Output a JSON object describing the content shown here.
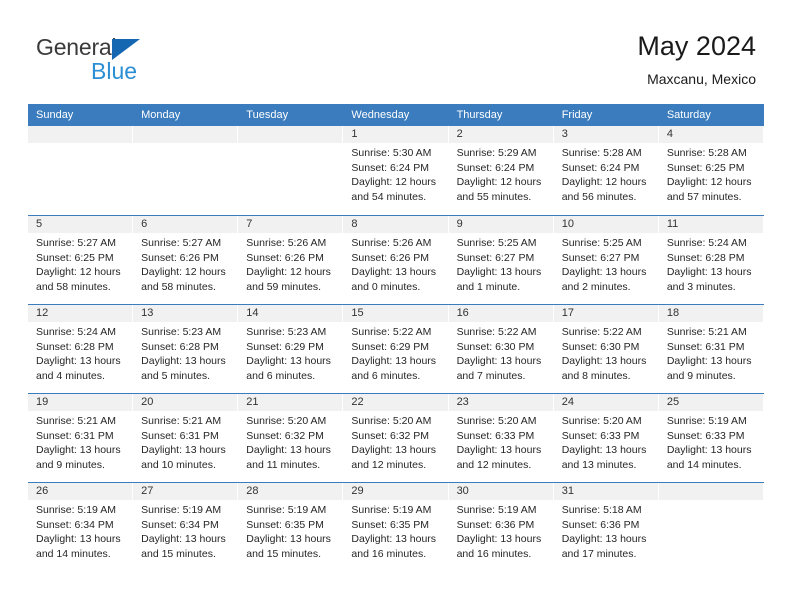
{
  "brand": {
    "name_top": "General",
    "name_bottom": "Blue",
    "triangle_color": "#1667b2",
    "blue_text_color": "#2a8fd4"
  },
  "header": {
    "title": "May 2024",
    "subtitle": "Maxcanu, Mexico"
  },
  "theme": {
    "header_blue": "#3a7cbe",
    "daynum_strip": "#f1f1f1",
    "text": "#262626"
  },
  "weekdays": [
    "Sunday",
    "Monday",
    "Tuesday",
    "Wednesday",
    "Thursday",
    "Friday",
    "Saturday"
  ],
  "weeks": [
    [
      {
        "day": "",
        "lines": []
      },
      {
        "day": "",
        "lines": []
      },
      {
        "day": "",
        "lines": []
      },
      {
        "day": "1",
        "lines": [
          "Sunrise: 5:30 AM",
          "Sunset: 6:24 PM",
          "Daylight: 12 hours",
          "and 54 minutes."
        ]
      },
      {
        "day": "2",
        "lines": [
          "Sunrise: 5:29 AM",
          "Sunset: 6:24 PM",
          "Daylight: 12 hours",
          "and 55 minutes."
        ]
      },
      {
        "day": "3",
        "lines": [
          "Sunrise: 5:28 AM",
          "Sunset: 6:24 PM",
          "Daylight: 12 hours",
          "and 56 minutes."
        ]
      },
      {
        "day": "4",
        "lines": [
          "Sunrise: 5:28 AM",
          "Sunset: 6:25 PM",
          "Daylight: 12 hours",
          "and 57 minutes."
        ]
      }
    ],
    [
      {
        "day": "5",
        "lines": [
          "Sunrise: 5:27 AM",
          "Sunset: 6:25 PM",
          "Daylight: 12 hours",
          "and 58 minutes."
        ]
      },
      {
        "day": "6",
        "lines": [
          "Sunrise: 5:27 AM",
          "Sunset: 6:26 PM",
          "Daylight: 12 hours",
          "and 58 minutes."
        ]
      },
      {
        "day": "7",
        "lines": [
          "Sunrise: 5:26 AM",
          "Sunset: 6:26 PM",
          "Daylight: 12 hours",
          "and 59 minutes."
        ]
      },
      {
        "day": "8",
        "lines": [
          "Sunrise: 5:26 AM",
          "Sunset: 6:26 PM",
          "Daylight: 13 hours",
          "and 0 minutes."
        ]
      },
      {
        "day": "9",
        "lines": [
          "Sunrise: 5:25 AM",
          "Sunset: 6:27 PM",
          "Daylight: 13 hours",
          "and 1 minute."
        ]
      },
      {
        "day": "10",
        "lines": [
          "Sunrise: 5:25 AM",
          "Sunset: 6:27 PM",
          "Daylight: 13 hours",
          "and 2 minutes."
        ]
      },
      {
        "day": "11",
        "lines": [
          "Sunrise: 5:24 AM",
          "Sunset: 6:28 PM",
          "Daylight: 13 hours",
          "and 3 minutes."
        ]
      }
    ],
    [
      {
        "day": "12",
        "lines": [
          "Sunrise: 5:24 AM",
          "Sunset: 6:28 PM",
          "Daylight: 13 hours",
          "and 4 minutes."
        ]
      },
      {
        "day": "13",
        "lines": [
          "Sunrise: 5:23 AM",
          "Sunset: 6:28 PM",
          "Daylight: 13 hours",
          "and 5 minutes."
        ]
      },
      {
        "day": "14",
        "lines": [
          "Sunrise: 5:23 AM",
          "Sunset: 6:29 PM",
          "Daylight: 13 hours",
          "and 6 minutes."
        ]
      },
      {
        "day": "15",
        "lines": [
          "Sunrise: 5:22 AM",
          "Sunset: 6:29 PM",
          "Daylight: 13 hours",
          "and 6 minutes."
        ]
      },
      {
        "day": "16",
        "lines": [
          "Sunrise: 5:22 AM",
          "Sunset: 6:30 PM",
          "Daylight: 13 hours",
          "and 7 minutes."
        ]
      },
      {
        "day": "17",
        "lines": [
          "Sunrise: 5:22 AM",
          "Sunset: 6:30 PM",
          "Daylight: 13 hours",
          "and 8 minutes."
        ]
      },
      {
        "day": "18",
        "lines": [
          "Sunrise: 5:21 AM",
          "Sunset: 6:31 PM",
          "Daylight: 13 hours",
          "and 9 minutes."
        ]
      }
    ],
    [
      {
        "day": "19",
        "lines": [
          "Sunrise: 5:21 AM",
          "Sunset: 6:31 PM",
          "Daylight: 13 hours",
          "and 9 minutes."
        ]
      },
      {
        "day": "20",
        "lines": [
          "Sunrise: 5:21 AM",
          "Sunset: 6:31 PM",
          "Daylight: 13 hours",
          "and 10 minutes."
        ]
      },
      {
        "day": "21",
        "lines": [
          "Sunrise: 5:20 AM",
          "Sunset: 6:32 PM",
          "Daylight: 13 hours",
          "and 11 minutes."
        ]
      },
      {
        "day": "22",
        "lines": [
          "Sunrise: 5:20 AM",
          "Sunset: 6:32 PM",
          "Daylight: 13 hours",
          "and 12 minutes."
        ]
      },
      {
        "day": "23",
        "lines": [
          "Sunrise: 5:20 AM",
          "Sunset: 6:33 PM",
          "Daylight: 13 hours",
          "and 12 minutes."
        ]
      },
      {
        "day": "24",
        "lines": [
          "Sunrise: 5:20 AM",
          "Sunset: 6:33 PM",
          "Daylight: 13 hours",
          "and 13 minutes."
        ]
      },
      {
        "day": "25",
        "lines": [
          "Sunrise: 5:19 AM",
          "Sunset: 6:33 PM",
          "Daylight: 13 hours",
          "and 14 minutes."
        ]
      }
    ],
    [
      {
        "day": "26",
        "lines": [
          "Sunrise: 5:19 AM",
          "Sunset: 6:34 PM",
          "Daylight: 13 hours",
          "and 14 minutes."
        ]
      },
      {
        "day": "27",
        "lines": [
          "Sunrise: 5:19 AM",
          "Sunset: 6:34 PM",
          "Daylight: 13 hours",
          "and 15 minutes."
        ]
      },
      {
        "day": "28",
        "lines": [
          "Sunrise: 5:19 AM",
          "Sunset: 6:35 PM",
          "Daylight: 13 hours",
          "and 15 minutes."
        ]
      },
      {
        "day": "29",
        "lines": [
          "Sunrise: 5:19 AM",
          "Sunset: 6:35 PM",
          "Daylight: 13 hours",
          "and 16 minutes."
        ]
      },
      {
        "day": "30",
        "lines": [
          "Sunrise: 5:19 AM",
          "Sunset: 6:36 PM",
          "Daylight: 13 hours",
          "and 16 minutes."
        ]
      },
      {
        "day": "31",
        "lines": [
          "Sunrise: 5:18 AM",
          "Sunset: 6:36 PM",
          "Daylight: 13 hours",
          "and 17 minutes."
        ]
      },
      {
        "day": "",
        "lines": []
      }
    ]
  ]
}
